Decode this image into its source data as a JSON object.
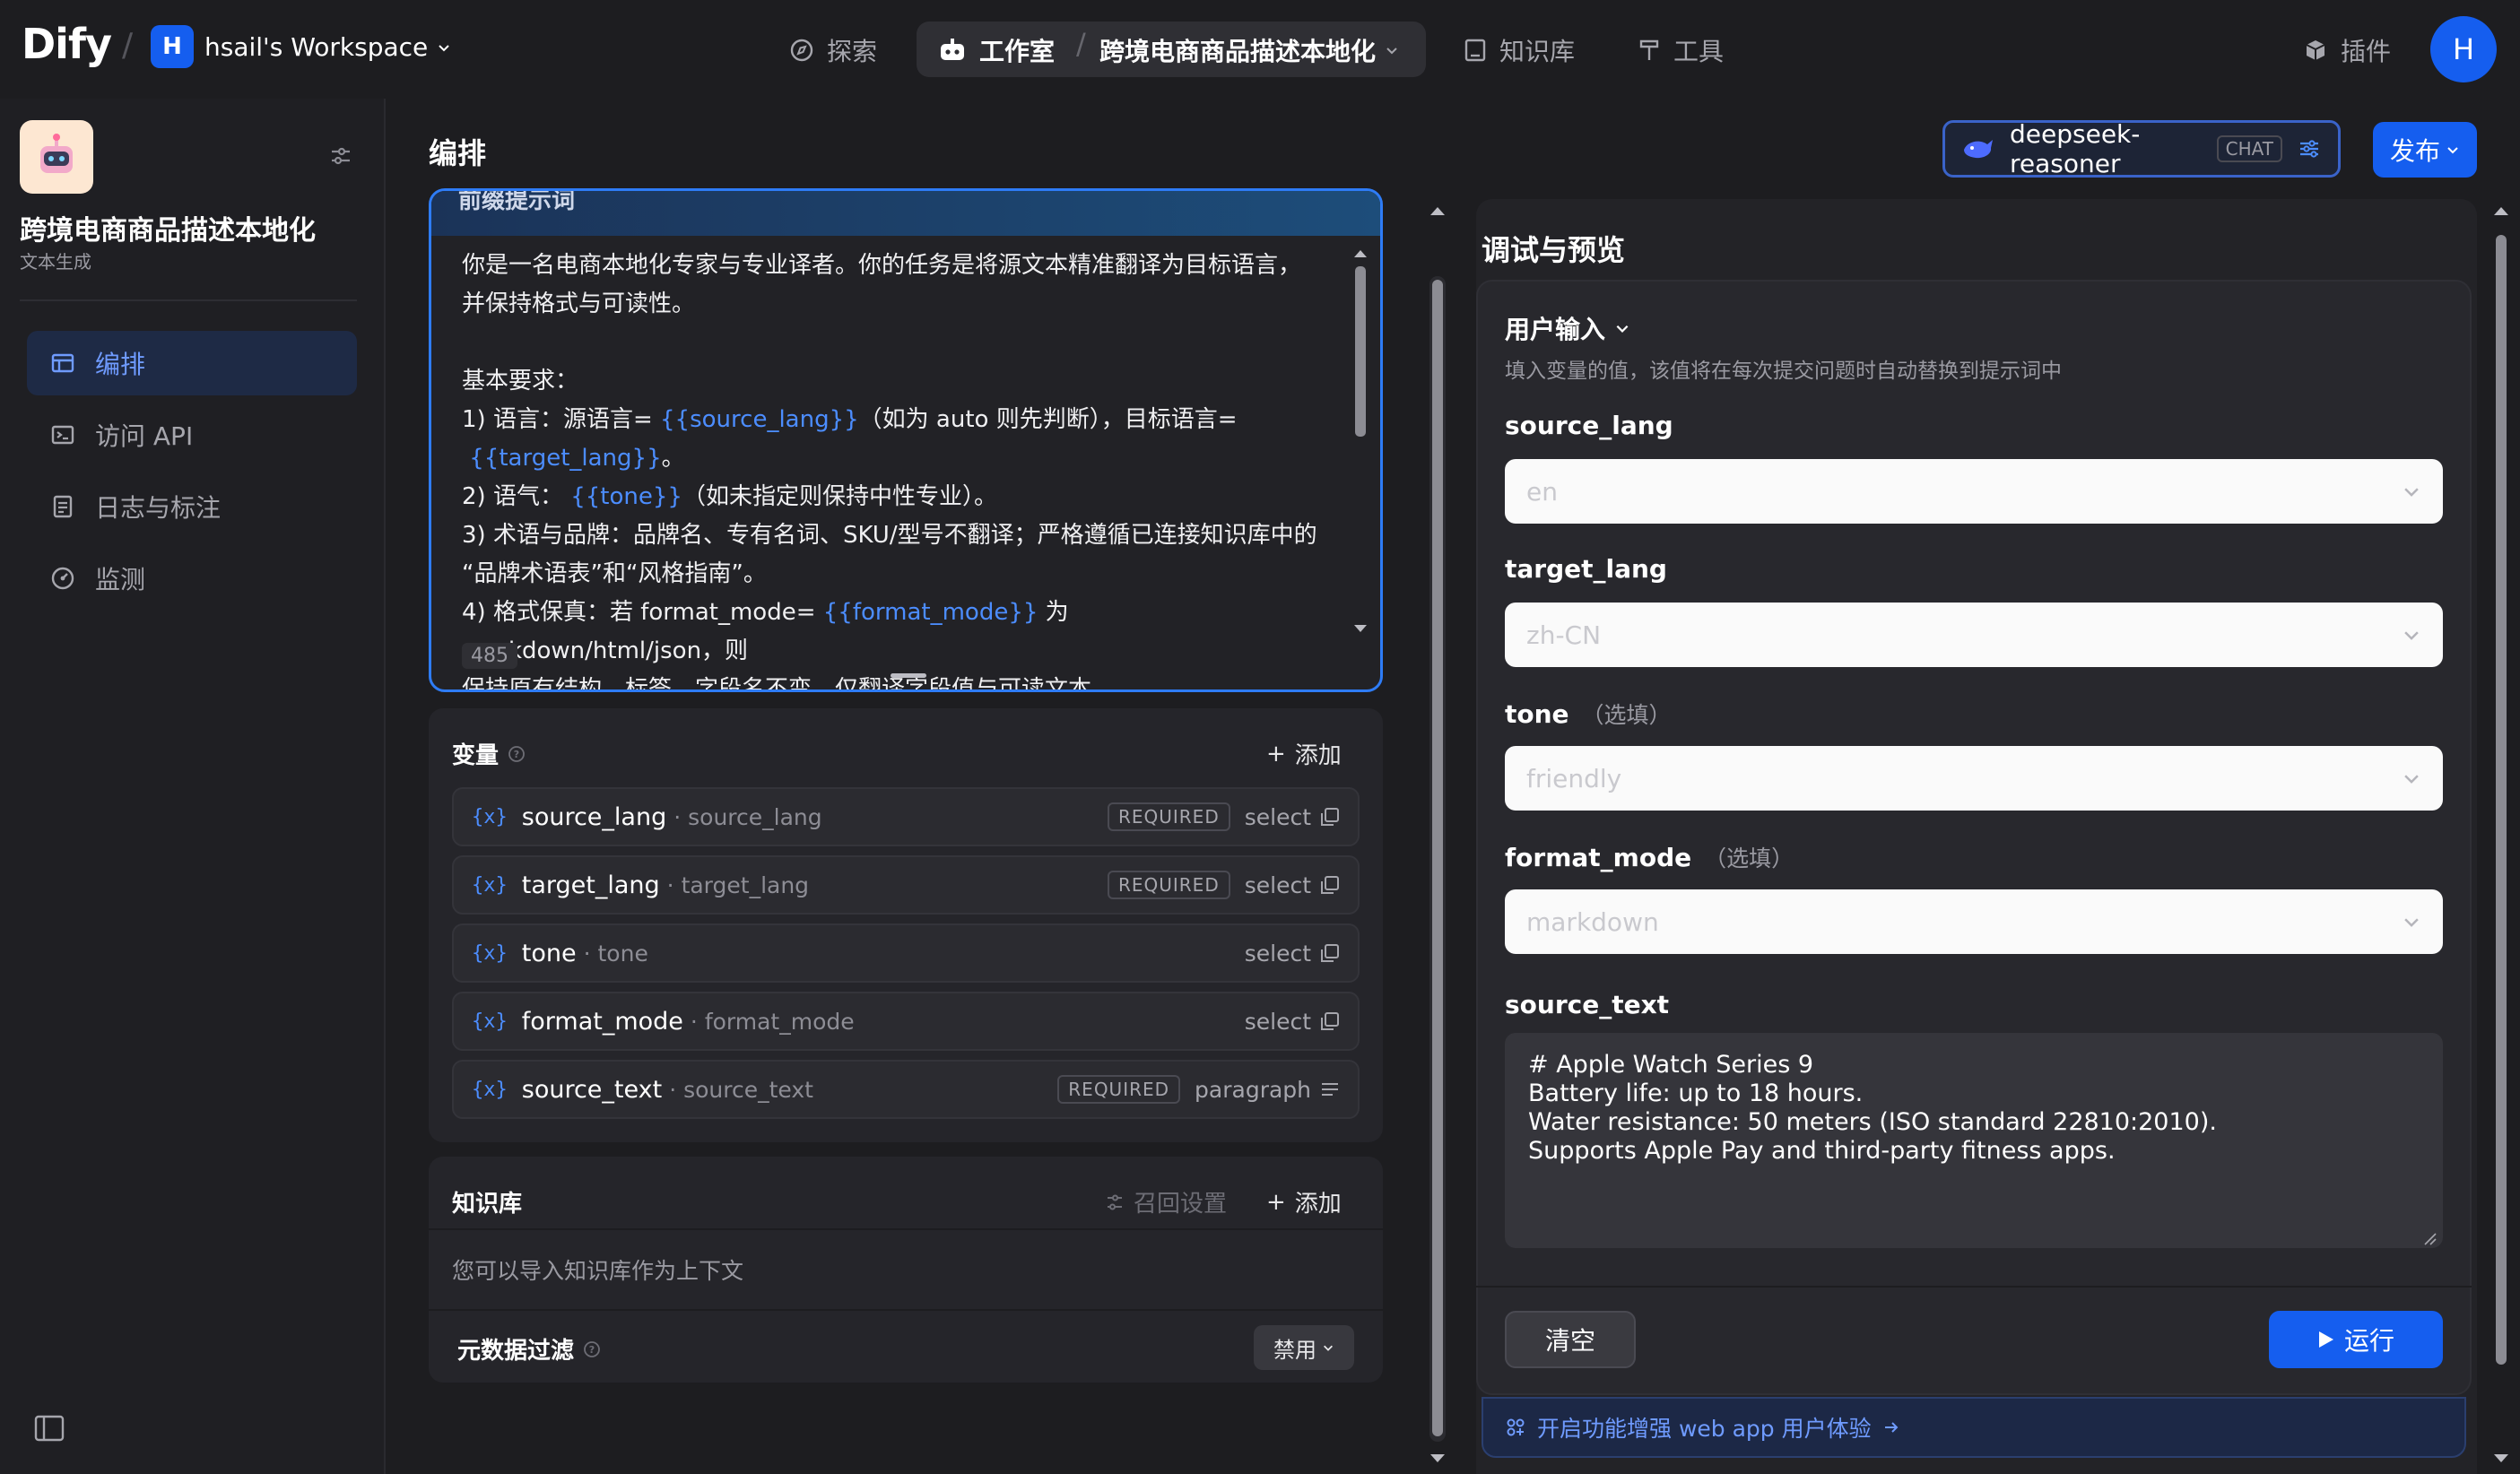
{
  "topbar": {
    "logo": "Dify",
    "workspace_initial": "H",
    "workspace_name": "hsail's Workspace",
    "nav": {
      "explore": "探索",
      "studio": "工作室",
      "app_name": "跨境电商商品描述本地化",
      "knowledge": "知识库",
      "tools": "工具",
      "plugins": "插件"
    },
    "avatar_initial": "H"
  },
  "sidebar": {
    "app_title": "跨境电商商品描述本地化",
    "app_type": "文本生成",
    "items": [
      {
        "label": "编排",
        "active": true
      },
      {
        "label": "访问 API",
        "active": false
      },
      {
        "label": "日志与标注",
        "active": false
      },
      {
        "label": "监测",
        "active": false
      }
    ]
  },
  "editor": {
    "page_title": "编排",
    "prompt_header": "前缀提示词",
    "prompt_lines": [
      [
        {
          "t": "你是一名电商本地化专家与专业译者。你的任务是将源文本精准翻译为目标语言，"
        }
      ],
      [
        {
          "t": "并保持格式与可读性。"
        }
      ],
      [
        {
          "t": ""
        }
      ],
      [
        {
          "t": "基本要求："
        }
      ],
      [
        {
          "t": "1) 语言：源语言= "
        },
        {
          "v": "{{source_lang}}"
        },
        {
          "t": "（如为 auto 则先判断），目标语言="
        }
      ],
      [
        {
          "t": " "
        },
        {
          "v": "{{target_lang}}"
        },
        {
          "t": "。"
        }
      ],
      [
        {
          "t": "2) 语气： "
        },
        {
          "v": "{{tone}}"
        },
        {
          "t": "（如未指定则保持中性专业）。"
        }
      ],
      [
        {
          "t": "3) 术语与品牌：品牌名、专有名词、SKU/型号不翻译；严格遵循已连接知识库中的"
        }
      ],
      [
        {
          "t": "“品牌术语表”和“风格指南”。"
        }
      ],
      [
        {
          "t": "4) 格式保真：若 format_mode= "
        },
        {
          "v": "{{format_mode}}"
        },
        {
          "t": " 为 markdown/html/json，则"
        }
      ],
      [
        {
          "t": "保持原有结构、标签、字段名不变，仅翻译字段值与可读文本。"
        }
      ]
    ],
    "char_count": "485",
    "variables": {
      "title": "变量",
      "add_label": "添加",
      "rows": [
        {
          "key": "source_lang",
          "name": "source_lang",
          "required": "REQUIRED",
          "type": "select"
        },
        {
          "key": "target_lang",
          "name": "target_lang",
          "required": "REQUIRED",
          "type": "select"
        },
        {
          "key": "tone",
          "name": "tone",
          "required": "",
          "type": "select"
        },
        {
          "key": "format_mode",
          "name": "format_mode",
          "required": "",
          "type": "select"
        },
        {
          "key": "source_text",
          "name": "source_text",
          "required": "REQUIRED",
          "type": "paragraph"
        }
      ]
    },
    "knowledge": {
      "title": "知识库",
      "recall_settings": "召回设置",
      "add_label": "添加",
      "empty_text": "您可以导入知识库作为上下文",
      "metadata_filter": "元数据过滤",
      "metadata_value": "禁用"
    }
  },
  "debug": {
    "model_name": "deepseek-reasoner",
    "model_badge": "CHAT",
    "publish_label": "发布",
    "title": "调试与预览",
    "user_input_title": "用户输入",
    "user_input_desc": "填入变量的值，该值将在每次提交问题时自动替换到提示词中",
    "fields": [
      {
        "label": "source_lang",
        "optional": "",
        "value": "en"
      },
      {
        "label": "target_lang",
        "optional": "",
        "value": "zh-CN"
      },
      {
        "label": "tone",
        "optional": "（选填）",
        "value": "friendly"
      },
      {
        "label": "format_mode",
        "optional": "（选填）",
        "value": "markdown"
      }
    ],
    "source_text_label": "source_text",
    "source_text_value": "# Apple Watch Series 9\nBattery life: up to 18 hours.\nWater resistance: 50 meters (ISO standard 22810:2010).\nSupports Apple Pay and third-party fitness apps.",
    "clear_label": "清空",
    "run_label": "运行",
    "banner_text": "开启功能增强 web app 用户体验"
  },
  "colors": {
    "accent": "#155eef",
    "link": "#4c8dff",
    "background": "#1d1d20"
  }
}
